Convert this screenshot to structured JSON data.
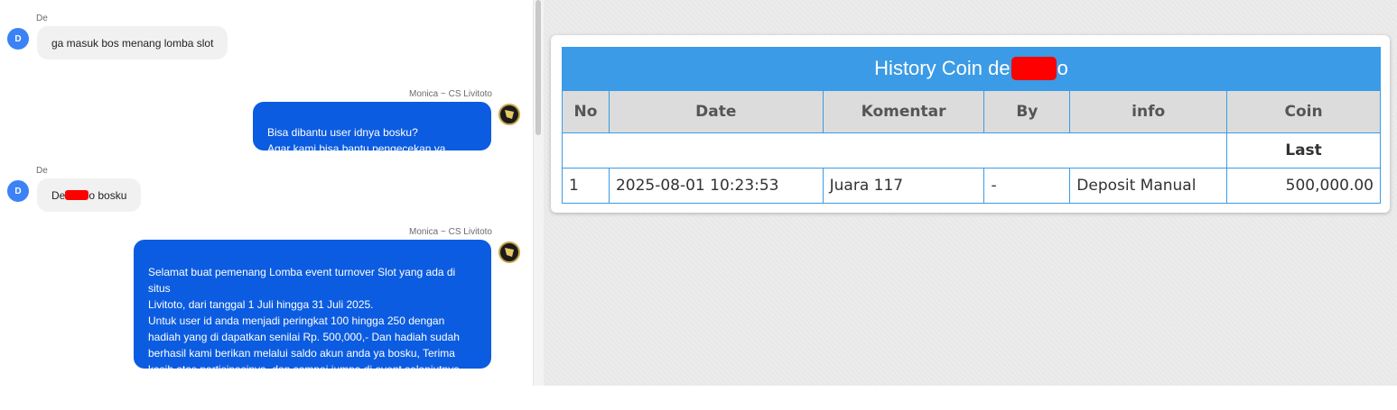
{
  "chat": {
    "messages": [
      {
        "sender": "De",
        "avatar": "D",
        "text": "ga masuk bos menang lomba slot"
      },
      {
        "sender": "Monica ~ CS Livitoto",
        "text": "Bisa dibantu user idnya bosku?\nAgar kami bisa bantu pengecekan ya bosku"
      },
      {
        "sender": "De",
        "avatar": "D",
        "text_prefix": "De",
        "text_suffix": "o bosku"
      },
      {
        "sender": "Monica ~ CS Livitoto",
        "text": "Selamat buat pemenang Lomba event turnover Slot yang ada di situs\nLivitoto, dari tanggal 1 Juli hingga 31 Juli 2025.\nUntuk user id anda menjadi peringkat 100 hingga 250 dengan\nhadiah yang di dapatkan senilai Rp. 500,000,- Dan hadiah sudah\nberhasil kami berikan melalui saldo akun anda ya bosku, Terima\nkasih atas partisipasinya, dan sampai jumpa di event selanjutnya, ya\nbosku"
      }
    ]
  },
  "history": {
    "title_prefix": "History Coin de",
    "title_suffix": "o",
    "headers": [
      "No",
      "Date",
      "Komentar",
      "By",
      "info",
      "Coin"
    ],
    "last_label": "Last",
    "rows": [
      {
        "no": "1",
        "date": "2025-08-01 10:23:53",
        "komentar": "Juara 117",
        "by": "-",
        "info": "Deposit Manual",
        "coin": "500,000.00"
      }
    ]
  },
  "colors": {
    "header_blue": "#3b9be6",
    "bubble_blue": "#0b5ce0",
    "avatar_blue": "#3b82f6",
    "coin_green": "#2a9a2a",
    "redaction": "#ff0000"
  }
}
